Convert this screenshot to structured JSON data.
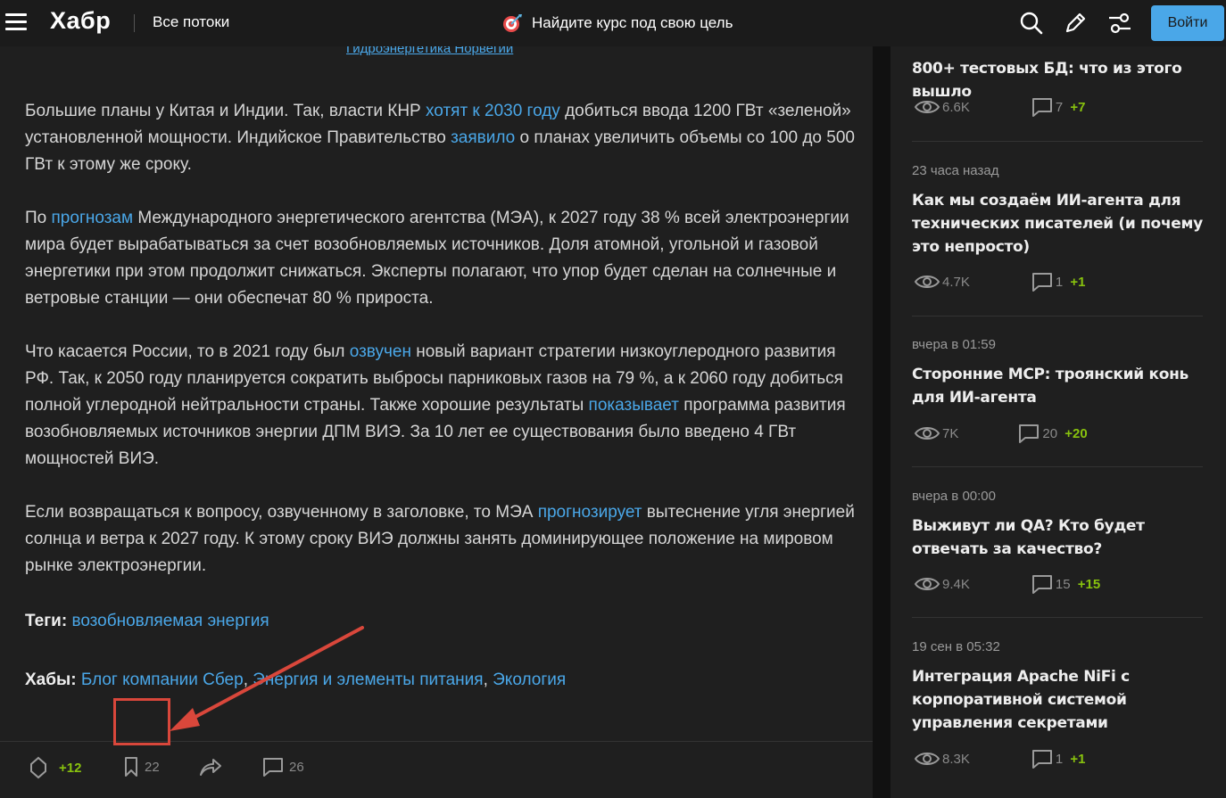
{
  "topbar": {
    "logo": "Хабр",
    "streams": "Все потоки",
    "promo": "Найдите курс под свою цель",
    "login": "Войти",
    "icons": [
      "menu-icon",
      "target-icon",
      "search-icon",
      "pencil-icon",
      "settings-icon"
    ]
  },
  "article": {
    "cut_caption": "Гидроэнергетика Норвегии",
    "p1": {
      "t1": "Большие планы у Китая и Индии. Так, власти КНР ",
      "l1": "хотят к 2030 году",
      "t2": " добиться ввода 1200 ГВт «зеленой» установленной мощности. Индийское Правительство ",
      "l2": "заявило",
      "t3": " о планах увеличить объемы со 100 до 500 ГВт к этому же сроку."
    },
    "p2": {
      "t1": "По ",
      "l1": "прогнозам",
      "t2": " Международного энергетического агентства (МЭА), к 2027 году 38 % всей электроэнергии мира будет вырабатываться за счет возобновляемых источников. Доля атомной, угольной и газовой энергетики при этом продолжит снижаться. Эксперты полагают, что упор будет сделан на солнечные и ветровые станции — они обеспечат 80 % прироста."
    },
    "p3": {
      "t1": "Что касается России, то в 2021 году был ",
      "l1": "озвучен",
      "t2": " новый вариант стратегии низкоуглеродного развития РФ. Так, к 2050 году планируется сократить выбросы парниковых газов на 79 %, а к 2060 году добиться полной углеродной нейтральности страны. Также хорошие результаты ",
      "l2": "показывает",
      "t3": " программа развития возобновляемых источников энергии ДПМ ВИЭ. За 10 лет ее существования было введено 4 ГВт мощностей ВИЭ."
    },
    "p4": {
      "t1": "Если возвращаться к вопросу, озвученному в заголовке, то МЭА ",
      "l1": "прогнозирует",
      "t2": " вытеснение угля энергией солнца и ветра к 2027 году. К этому сроку ВИЭ должны занять доминирующее положение на мировом рынке электроэнергии."
    },
    "tags_label": "Теги:",
    "tags": [
      "возобновляемая энергия"
    ],
    "hubs_label": "Хабы:",
    "hubs": [
      "Блог компании Сбер",
      "Энергия и элементы питания",
      "Экология"
    ],
    "footer": {
      "score": "+12",
      "bookmarks": "22",
      "comments": "26"
    }
  },
  "sidebar": {
    "posts": [
      {
        "time": "",
        "title": "800+ тестовых БД: что из этого вышло",
        "views": "6.6K",
        "comments": "7",
        "new_comments": "+7"
      },
      {
        "time": "23 часа назад",
        "title": "Как мы создаём ИИ-агента для технических писателей (и почему это непросто)",
        "views": "4.7K",
        "comments": "1",
        "new_comments": "+1"
      },
      {
        "time": "вчера в 01:59",
        "title": "Сторонние MCP: троянский конь для ИИ-агента",
        "views": "7K",
        "comments": "20",
        "new_comments": "+20"
      },
      {
        "time": "вчера в 00:00",
        "title": "Выживут ли QA? Кто будет отвечать за качество?",
        "views": "9.4K",
        "comments": "15",
        "new_comments": "+15"
      },
      {
        "time": "19 сен в 05:32",
        "title": "Интеграция Apache NiFi с корпоративной системой управления секретами",
        "views": "8.3K",
        "comments": "1",
        "new_comments": "+1"
      }
    ]
  },
  "colors": {
    "accent": "#4aa7e8",
    "score": "#88c20e",
    "annotation": "#d9473b"
  }
}
